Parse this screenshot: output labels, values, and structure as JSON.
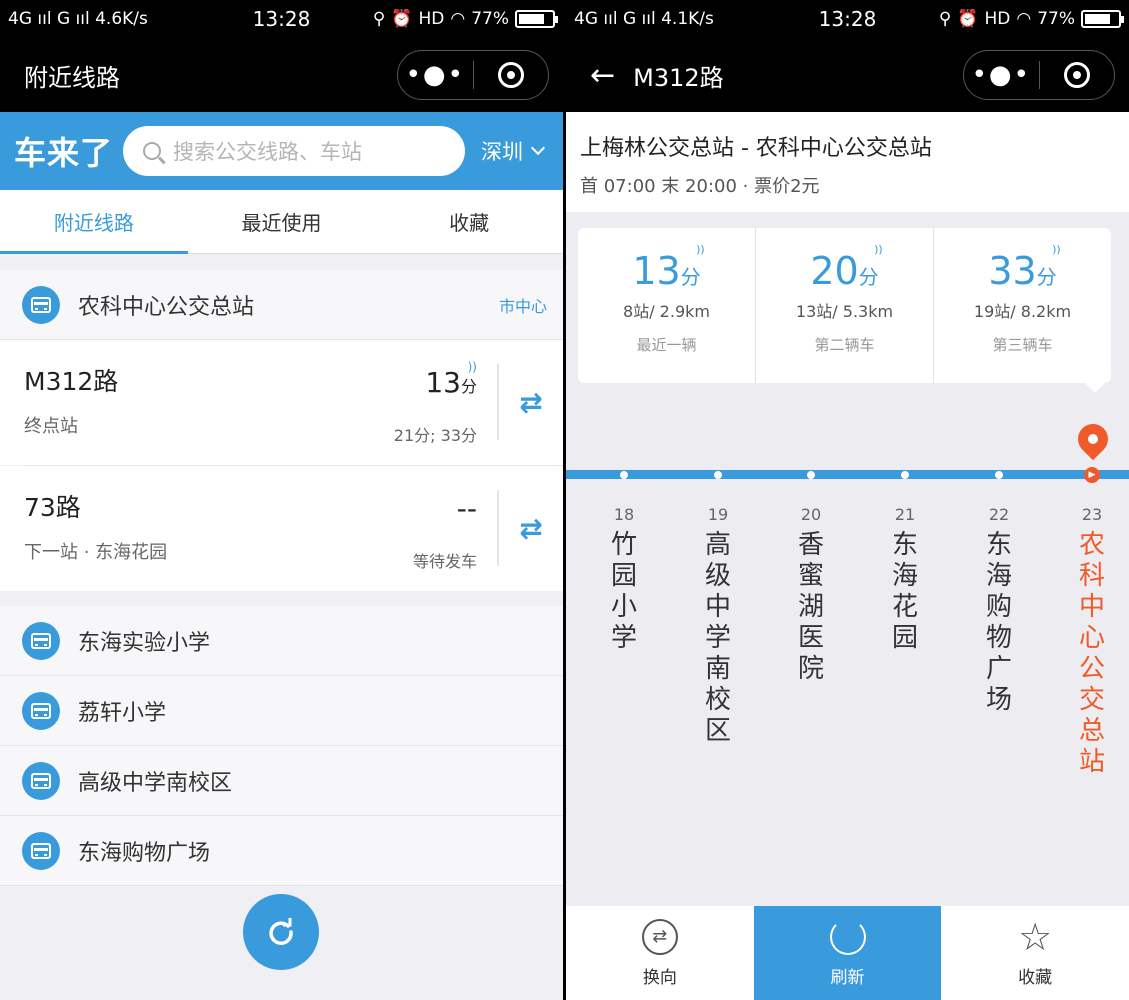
{
  "left": {
    "status": {
      "signal": "4G ııl G ııl 4.6K/s",
      "time": "13:28",
      "right": "HD",
      "battery": "77%"
    },
    "nav_title": "附近线路",
    "brand": "车来了",
    "search_placeholder": "搜索公交线路、车站",
    "city": "深圳",
    "tabs": [
      {
        "label": "附近线路"
      },
      {
        "label": "最近使用"
      },
      {
        "label": "收藏"
      }
    ],
    "nearby_station": {
      "name": "农科中心公交总站",
      "area": "市中心"
    },
    "routes": [
      {
        "name": "M312路",
        "sub": "终点站",
        "eta": "13",
        "eta_unit": "分",
        "next": "21分; 33分"
      },
      {
        "name": "73路",
        "sub": "下一站 · 东海花园",
        "eta": "--",
        "eta_unit": "",
        "next": "等待发车"
      }
    ],
    "other_stations": [
      "东海实验小学",
      "荔轩小学",
      "高级中学南校区",
      "东海购物广场"
    ]
  },
  "right": {
    "status": {
      "signal": "4G ııl G ııl 4.1K/s",
      "time": "13:28",
      "right": "HD",
      "battery": "77%"
    },
    "nav_title": "M312路",
    "line_title": "上梅林公交总站 - 农科中心公交总站",
    "schedule": "首 07:00 末 20:00 · 票价2元",
    "etas": [
      {
        "min": "13",
        "unit": "分",
        "dist": "8站/ 2.9km",
        "rank": "最近一辆"
      },
      {
        "min": "20",
        "unit": "分",
        "dist": "13站/ 5.3km",
        "rank": "第二辆车"
      },
      {
        "min": "33",
        "unit": "分",
        "dist": "19站/ 8.2km",
        "rank": "第三辆车"
      }
    ],
    "stops": [
      {
        "no": "18",
        "name": "竹园小学"
      },
      {
        "no": "19",
        "name": "高级中学南校区"
      },
      {
        "no": "20",
        "name": "香蜜湖医院"
      },
      {
        "no": "21",
        "name": "东海花园"
      },
      {
        "no": "22",
        "name": "东海购物广场"
      },
      {
        "no": "23",
        "name": "农科中心公交总站"
      }
    ],
    "bottom": [
      {
        "label": "换向"
      },
      {
        "label": "刷新"
      },
      {
        "label": "收藏"
      }
    ]
  },
  "colors": {
    "accent": "#3a9bdc",
    "current": "#f05a2a"
  }
}
